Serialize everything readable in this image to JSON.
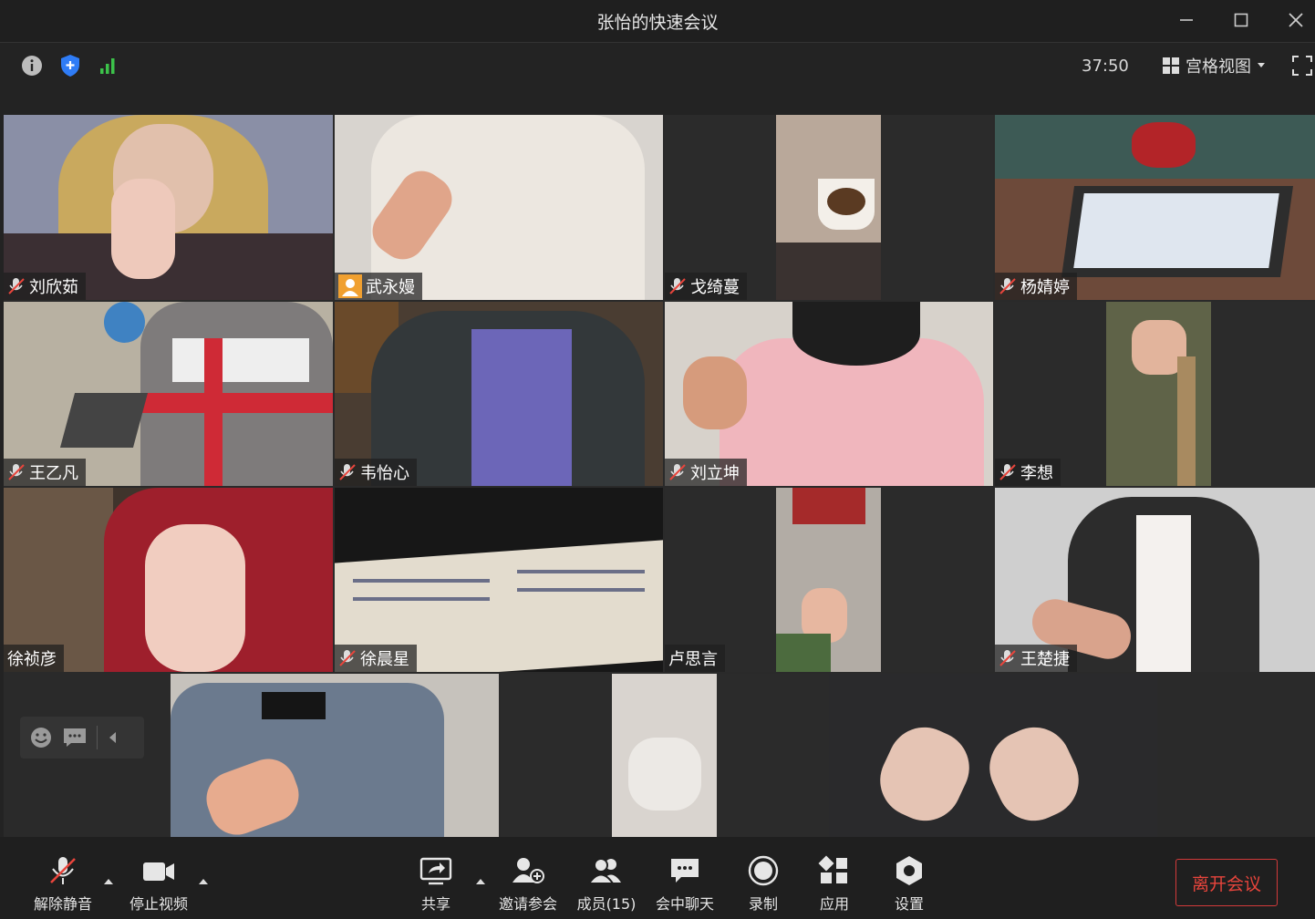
{
  "window": {
    "title": "张怡的快速会议"
  },
  "infobar": {
    "timer": "37:50",
    "view_label": "宫格视图"
  },
  "participants": [
    {
      "name": "刘欣茹",
      "muted": true
    },
    {
      "name": "武永嫚",
      "muted": false,
      "avatar": true
    },
    {
      "name": "戈绮蔓",
      "muted": true
    },
    {
      "name": "杨婧婷",
      "muted": true
    },
    {
      "name": "王乙凡",
      "muted": true
    },
    {
      "name": "韦怡心",
      "muted": true
    },
    {
      "name": "刘立坤",
      "muted": true
    },
    {
      "name": "李想",
      "muted": true
    },
    {
      "name": "徐祯彦",
      "muted": false
    },
    {
      "name": "徐晨星",
      "muted": true
    },
    {
      "name": "卢思言",
      "muted": false
    },
    {
      "name": "王楚捷",
      "muted": true
    }
  ],
  "toolbar": {
    "unmute": "解除静音",
    "stop_video": "停止视频",
    "share": "共享",
    "invite": "邀请参会",
    "members": "成员(15)",
    "chat": "会中聊天",
    "record": "录制",
    "apps": "应用",
    "settings": "设置",
    "leave": "离开会议"
  },
  "colors": {
    "accent_red": "#e8453c",
    "signal_green": "#3cc24a",
    "shield_blue": "#2f7cf6"
  }
}
